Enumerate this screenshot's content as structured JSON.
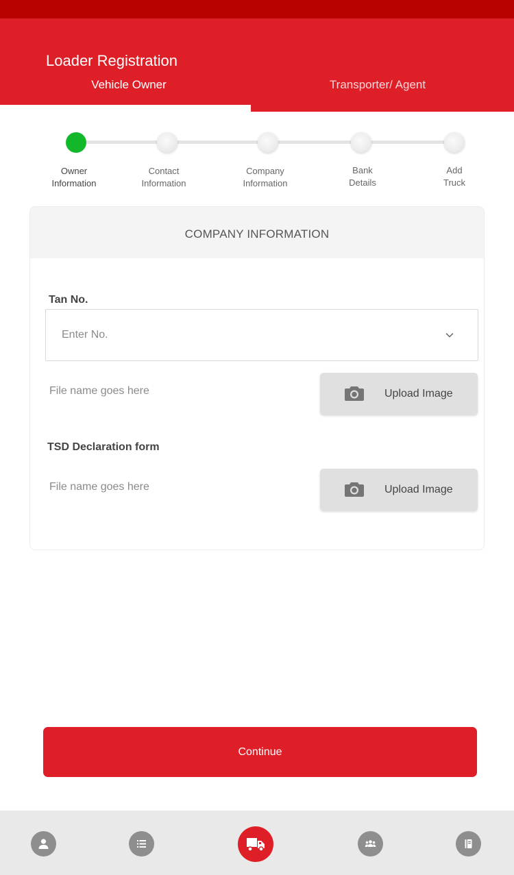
{
  "app": {
    "title": "Loader Registration",
    "accent_color": "#df1f28",
    "statusbar_color": "#b70000"
  },
  "tabs": [
    {
      "label": "Vehicle Owner",
      "active": true
    },
    {
      "label": "Transporter/ Agent",
      "active": false
    }
  ],
  "stepper": {
    "steps": [
      {
        "label": "Owner\nInformation",
        "completed": true
      },
      {
        "label": "Contact\nInformation",
        "completed": false
      },
      {
        "label": "Company\nInformation",
        "completed": false
      },
      {
        "label": "Bank\nDetails",
        "completed": false
      },
      {
        "label": "Add\nTruck",
        "completed": false
      }
    ],
    "completed_color": "#13b72a"
  },
  "card": {
    "title": "COMPANY INFORMATION",
    "tan": {
      "label": "Tan No.",
      "placeholder": "Enter No.",
      "value": ""
    },
    "tan_upload": {
      "file_name": "File name goes here",
      "button_label": "Upload Image"
    },
    "tsd": {
      "label": "TSD Declaration form",
      "file_name": "File name goes here",
      "button_label": "Upload Image"
    }
  },
  "continue_label": "Continue",
  "bottom_nav": [
    {
      "icon": "person-icon",
      "active": false
    },
    {
      "icon": "list-icon",
      "active": false
    },
    {
      "icon": "truck-icon",
      "active": true
    },
    {
      "icon": "group-icon",
      "active": false
    },
    {
      "icon": "book-icon",
      "active": false
    }
  ]
}
